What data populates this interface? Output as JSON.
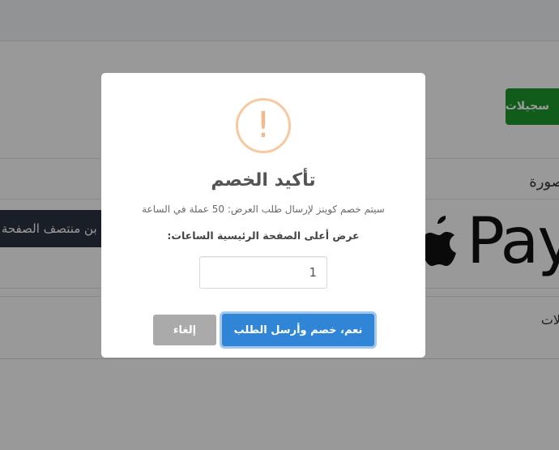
{
  "background": {
    "green_button_label": "سجيلات",
    "column_header": "صورة",
    "dark_banner_label": "بن منتصف الصفحة ال",
    "apple_pay_text": "Pay",
    "row_label": "لات"
  },
  "modal": {
    "icon_glyph": "!",
    "title": "تأكيد الخصم",
    "text": "سيتم خصم كوينز لإرسال طلب العرض: 50 عملة في الساعة",
    "hours_label": "عرض أعلى الصفحة الرئيسية الساعات:",
    "hours_value": "1",
    "confirm_label": "نعم، خصم وأرسل الطلب",
    "cancel_label": "إلغاء"
  },
  "colors": {
    "confirm": "#3085d6",
    "cancel": "#aaaaaa",
    "warning_icon": "#f8bb86",
    "green_button": "#1f9a2e",
    "dark_banner": "#2c3340"
  }
}
